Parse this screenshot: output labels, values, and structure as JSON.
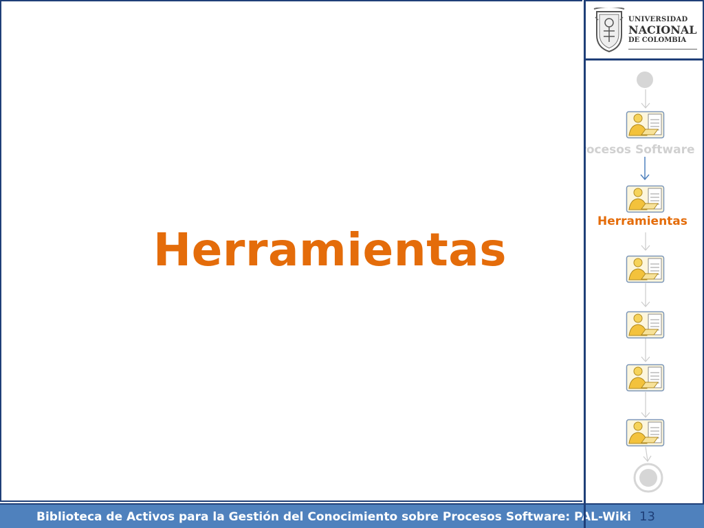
{
  "slide": {
    "title": "Herramientas"
  },
  "logo": {
    "line1": "UNIVERSIDAD",
    "line2": "NACIONAL",
    "line3": "DE COLOMBIA"
  },
  "flow": {
    "previous_step_label": "Procesos Software",
    "current_step_label": "Herramientas",
    "steps": [
      {
        "state": "done"
      },
      {
        "state": "current"
      },
      {
        "state": "pending"
      },
      {
        "state": "pending"
      },
      {
        "state": "pending"
      },
      {
        "state": "pending"
      }
    ]
  },
  "footer": {
    "text": "Biblioteca de Activos para la Gestión del Conocimiento sobre Procesos Software: PAL-Wiki",
    "page_number": "13"
  },
  "colors": {
    "accent_orange": "#e46c0a",
    "frame_blue": "#1f3f78",
    "footer_blue": "#4f81bd",
    "faded_gray": "#d0d0d0"
  }
}
